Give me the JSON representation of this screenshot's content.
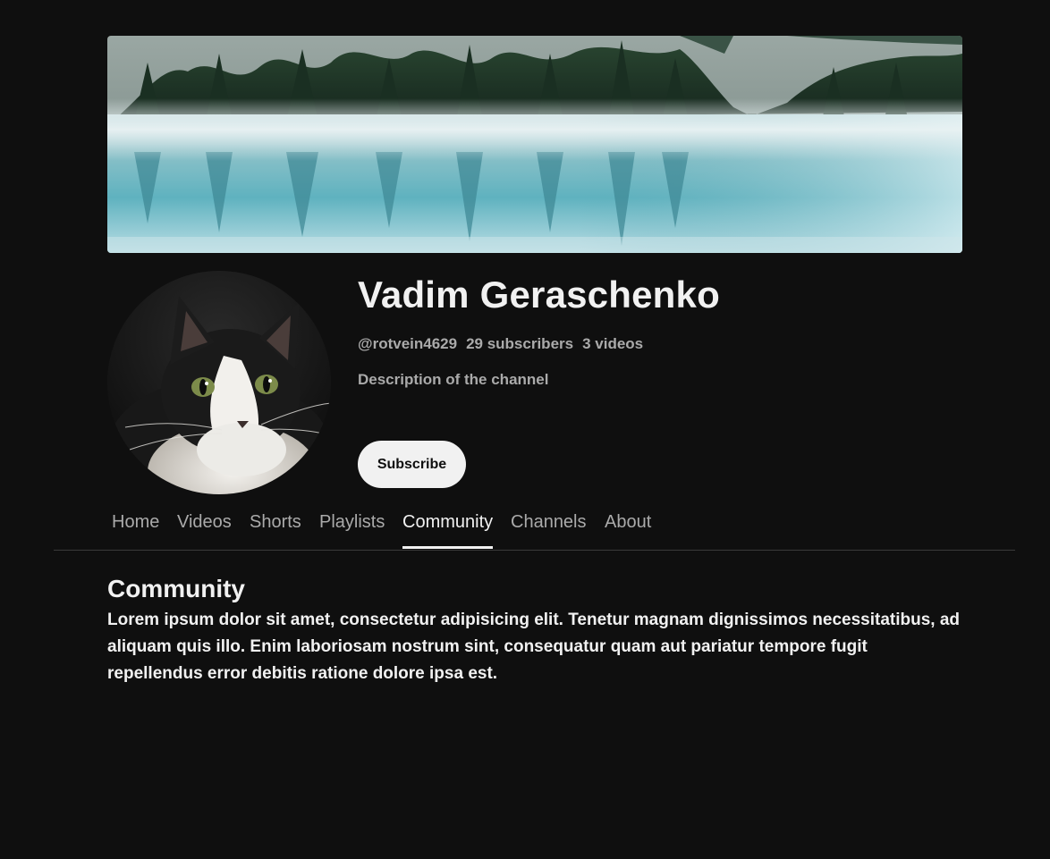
{
  "channel": {
    "name": "Vadim Geraschenko",
    "handle": "@rotvein4629",
    "subscribers": "29 subscribers",
    "videos": "3 videos",
    "description": "Description of the channel",
    "subscribe_label": "Subscribe"
  },
  "banner": {
    "image": "misty-lake-forest-banner"
  },
  "avatar": {
    "image": "black-and-white-cat-avatar"
  },
  "tabs": [
    {
      "label": "Home",
      "active": false
    },
    {
      "label": "Videos",
      "active": false
    },
    {
      "label": "Shorts",
      "active": false
    },
    {
      "label": "Playlists",
      "active": false
    },
    {
      "label": "Community",
      "active": true
    },
    {
      "label": "Channels",
      "active": false
    },
    {
      "label": "About",
      "active": false
    }
  ],
  "community": {
    "title": "Community",
    "body": "Lorem ipsum dolor sit amet, consectetur adipisicing elit. Tenetur magnam dignissimos necessitatibus, ad aliquam quis illo. Enim laboriosam nostrum sint, consequatur quam aut pariatur tempore fugit repellendus error debitis ratione dolore ipsa est."
  },
  "colors": {
    "background": "#0f0f0f",
    "text_primary": "#f1f1f1",
    "text_secondary": "#aaaaaa",
    "button_bg": "#f1f1f1"
  }
}
